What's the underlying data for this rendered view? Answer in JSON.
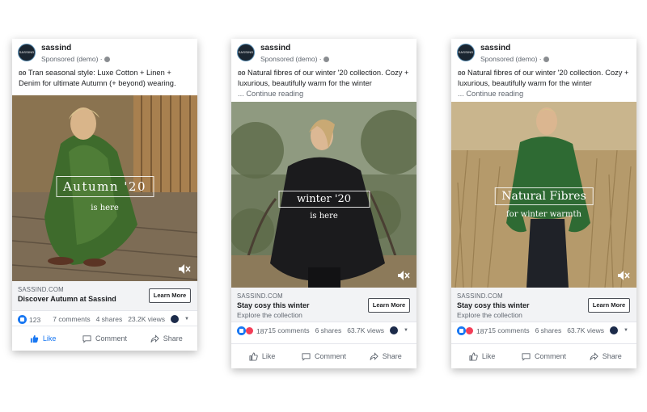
{
  "cards": [
    {
      "page_name": "sassind",
      "avatar_text": "SASSIND",
      "sponsored": "Sponsored (demo) ·",
      "body_text": "ʚʚ Tran seasonal style: Luxe Cotton + Linen + Denim for ultimate Autumn (+ beyond) wearing.",
      "more": "",
      "overlay_title": "Autumn '20",
      "overlay_subtitle": "is here",
      "domain": "SASSIND.COM",
      "headline": "Discover Autumn at Sassind",
      "description": "",
      "cta": "Learn More",
      "reaction_count": "123",
      "comments": "7 comments",
      "shares": "4 shares",
      "views": "23.2K views",
      "actions": {
        "like": "Like",
        "comment": "Comment",
        "share": "Share"
      }
    },
    {
      "page_name": "sassind",
      "avatar_text": "SASSIND",
      "sponsored": "Sponsored (demo) ·",
      "body_text": "ʚʚ Natural fibres of our winter '20 collection. Cozy + luxurious, beautifully warm for the winter",
      "more": "... Continue reading",
      "overlay_title": "winter '20",
      "overlay_subtitle": "is here",
      "domain": "SASSIND.COM",
      "headline": "Stay cosy this winter",
      "description": "Explore the collection",
      "cta": "Learn More",
      "reaction_count": "187",
      "comments": "15 comments",
      "shares": "6 shares",
      "views": "63.7K views",
      "actions": {
        "like": "Like",
        "comment": "Comment",
        "share": "Share"
      }
    },
    {
      "page_name": "sassind",
      "avatar_text": "SASSIND",
      "sponsored": "Sponsored (demo) ·",
      "body_text": "ʚʚ Natural fibres of our winter '20 collection. Cozy + luxurious, beautifully warm for the winter",
      "more": "... Continue reading",
      "overlay_title": "Natural Fibres",
      "overlay_subtitle": "for winter warmth",
      "domain": "SASSIND.COM",
      "headline": "Stay cosy this winter",
      "description": "Explore the collection",
      "cta": "Learn More",
      "reaction_count": "187",
      "comments": "15 comments",
      "shares": "6 shares",
      "views": "63.7K views",
      "actions": {
        "like": "Like",
        "comment": "Comment",
        "share": "Share"
      }
    }
  ],
  "colors": {
    "facebook_blue": "#1877f2",
    "love_red": "#f33e58",
    "muted_text": "#606770"
  }
}
